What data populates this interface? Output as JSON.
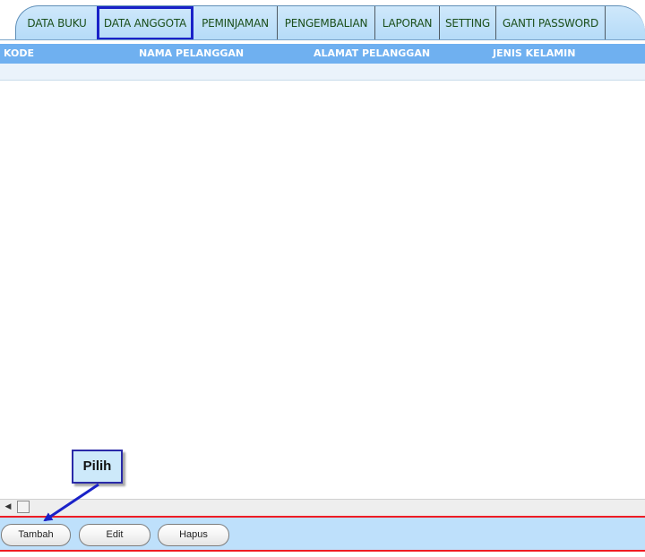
{
  "tabs": [
    {
      "label": "DATA BUKU"
    },
    {
      "label": "DATA ANGGOTA"
    },
    {
      "label": "PEMINJAMAN"
    },
    {
      "label": "PENGEMBALIAN"
    },
    {
      "label": "LAPORAN"
    },
    {
      "label": "SETTING"
    },
    {
      "label": "GANTI PASSWORD"
    }
  ],
  "grid": {
    "columns": [
      "KODE",
      "NAMA PELANGGAN",
      "ALAMAT PELANGGAN",
      "JENIS KELAMIN"
    ]
  },
  "buttons": {
    "tambah": "Tambah",
    "edit": "Edit",
    "hapus": "Hapus"
  },
  "callout": {
    "text": "Pilih"
  },
  "colors": {
    "highlight": "#1a22c8",
    "header": "#6fb0f0",
    "toolbar_border": "#ee1c24",
    "toolbar_bg": "#bee0fb",
    "arrow": "#1a22c8"
  },
  "icons": {
    "scroll_left": "triangle-left-icon"
  }
}
